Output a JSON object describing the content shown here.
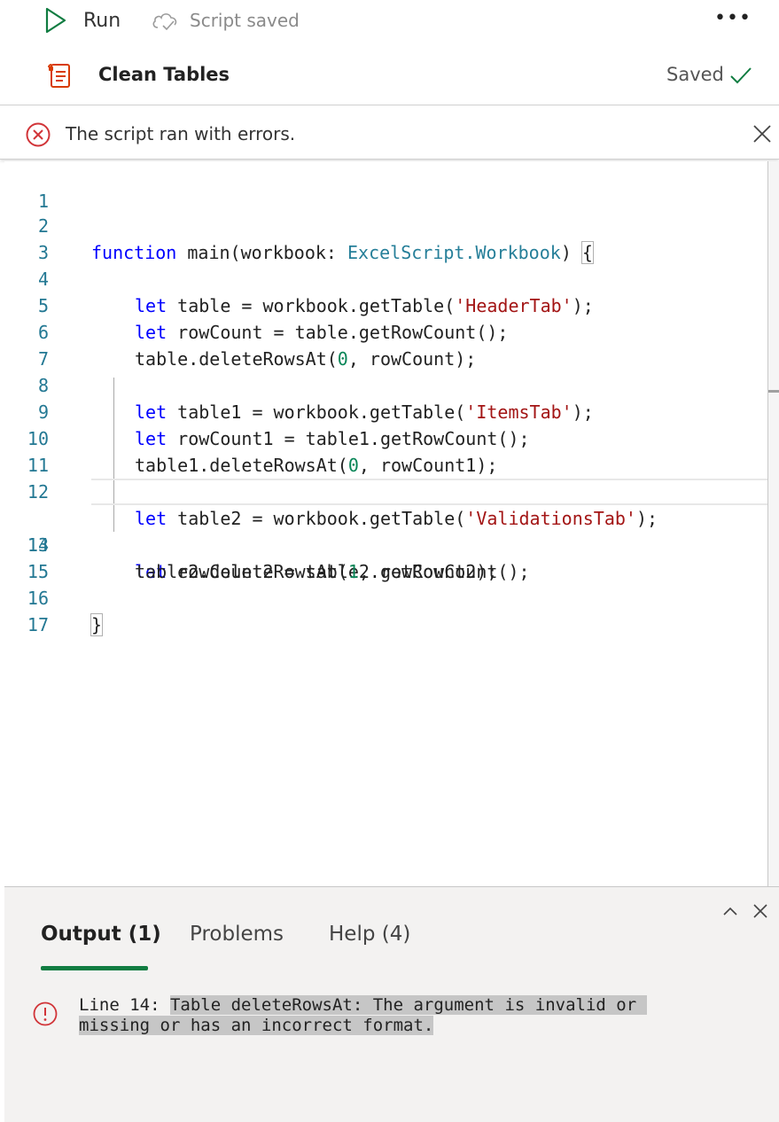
{
  "toolbar": {
    "run_label": "Run",
    "status_label": "Script saved",
    "more_label": "•••"
  },
  "script": {
    "title": "Clean Tables",
    "save_state": "Saved"
  },
  "error_banner": {
    "text": "The script ran with errors."
  },
  "editor": {
    "line_numbers": [
      "1",
      "2",
      "3",
      "4",
      "5",
      "6",
      "7",
      "8",
      "9",
      "10",
      "11",
      "12",
      "13",
      "14",
      "15",
      "16",
      "17"
    ],
    "code": {
      "l2": {
        "kw": "function",
        "mid": " main(workbook: ",
        "type": "ExcelScript.Workbook",
        "end": ") ",
        "brace": "{"
      },
      "l4": {
        "kw": "let",
        "a": " table = workbook.getTable(",
        "str": "'HeaderTab'",
        "b": ");"
      },
      "l5": {
        "kw": "let",
        "a": " rowCount = table.getRowCount();"
      },
      "l6": {
        "a": "table.deleteRowsAt(",
        "num": "0",
        "b": ", rowCount);"
      },
      "l8": {
        "kw": "let",
        "a": " table1 = workbook.getTable(",
        "str": "'ItemsTab'",
        "b": ");"
      },
      "l9": {
        "kw": "let",
        "a": " rowCount1 = table1.getRowCount();"
      },
      "l10": {
        "a": "table1.deleteRowsAt(",
        "num": "0",
        "b": ", rowCount1);"
      },
      "l12": {
        "kw": "let",
        "a": " table2 = workbook.getTable(",
        "str": "'ValidationsTab'",
        "b": ");"
      },
      "l13": {
        "kw": "let",
        "a": " rowCount2 = table2.getRowCount();"
      },
      "l14": {
        "a": "table2.deleteRowsAt(",
        "num": "1",
        "b": ", rowCount2);"
      },
      "l16": {
        "brace": "}"
      }
    }
  },
  "panel": {
    "tabs": {
      "output": "Output (1)",
      "problems": "Problems",
      "help": "Help (4)"
    },
    "message": {
      "prefix": "Line 14: ",
      "highlighted": "Table deleteRowsAt: The argument is invalid or missing or has an incorrect format."
    }
  },
  "colors": {
    "accent_green": "#107c41",
    "error_red": "#d13438",
    "keyword_blue": "#0000ff",
    "string_red": "#a31515",
    "type_teal": "#267f99",
    "number_green": "#098658",
    "line_number": "#237893"
  },
  "icons": {
    "run": "play-icon",
    "status": "cloud-check-icon",
    "script": "script-icon",
    "saved": "checkmark-icon",
    "banner_error": "error-circle-icon",
    "banner_close": "close-icon",
    "panel_collapse": "chevron-up-icon",
    "panel_close": "close-icon",
    "message": "exclamation-circle-icon"
  }
}
